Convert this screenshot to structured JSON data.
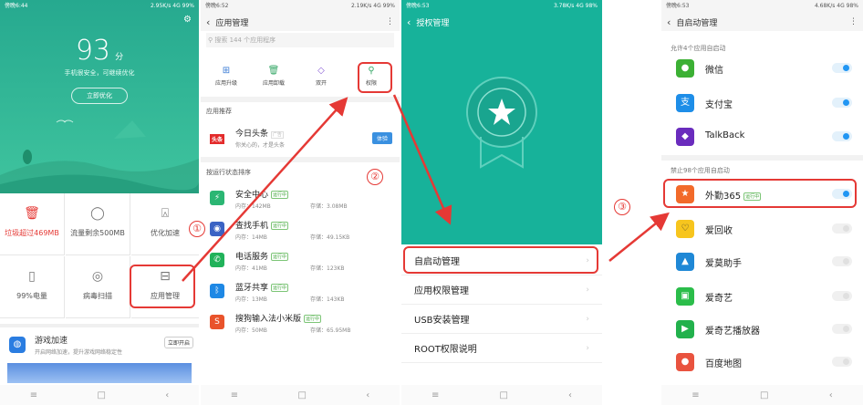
{
  "p1": {
    "status_left": "傍晚6:44",
    "status_right": "2.95K/s 4G 99%",
    "score": "93",
    "score_unit": "分",
    "status_msg": "手机很安全，可继续优化",
    "optimize": "立即优化",
    "grid": [
      {
        "label": "垃圾超过469MB",
        "icon": "trash-icon",
        "glyph": "🗑",
        "color": "#e53935"
      },
      {
        "label": "流量剩余500MB",
        "icon": "drop-icon",
        "glyph": "◯",
        "color": "#555555"
      },
      {
        "label": "优化加速",
        "icon": "rocket-icon",
        "glyph": "⍓",
        "color": "#555555"
      },
      {
        "label": "99%电量",
        "icon": "battery-icon",
        "glyph": "▯",
        "color": "#555555"
      },
      {
        "label": "病毒扫描",
        "icon": "shield-scan-icon",
        "glyph": "◎",
        "color": "#555555"
      },
      {
        "label": "应用管理",
        "icon": "app-box-icon",
        "glyph": "⊟",
        "color": "#555555"
      }
    ],
    "game_title": "游戏加速",
    "game_desc": "开启网络加速，提升游戏网络稳定性",
    "game_btn": "立即开启"
  },
  "p2": {
    "status_left": "傍晚6:52",
    "status_right": "2.19K/s 4G 99%",
    "title": "应用管理",
    "search_placeholder": "搜索 144 个应用程序",
    "tabs": [
      {
        "label": "应用升级",
        "icon": "upgrade-icon",
        "glyph": "⊞"
      },
      {
        "label": "应用卸载",
        "icon": "uninstall-icon",
        "glyph": "🗑"
      },
      {
        "label": "双开",
        "icon": "dual-icon",
        "glyph": "◇"
      },
      {
        "label": "权限",
        "icon": "permission-icon",
        "glyph": "⚲"
      }
    ],
    "rec_header": "应用推荐",
    "rec_logo": "头条",
    "rec_title": "今日头条",
    "rec_tag": "广告",
    "rec_desc": "你关心的，才是头条",
    "rec_btn": "体验",
    "sort_header": "按运行状态排序",
    "running_badge": "运行中",
    "apps": [
      {
        "name": "安全中心",
        "mem": "内存：142MB",
        "store": "",
        "icon": "security-center-icon",
        "color": "#2bb673"
      },
      {
        "name": "查找手机",
        "mem": "内存：14MB",
        "store": "存储：49.15KB",
        "icon": "find-phone-icon",
        "color": "#3b63c4"
      },
      {
        "name": "电话服务",
        "mem": "内存：41MB",
        "store": "存储：123KB",
        "icon": "phone-service-icon",
        "color": "#21b25a"
      },
      {
        "name": "蓝牙共享",
        "mem": "内存：13MB",
        "store": "存储：143KB",
        "icon": "bluetooth-icon",
        "color": "#1e88e5"
      },
      {
        "name": "搜狗输入法小米版",
        "mem": "内存：50MB",
        "store": "存储：65.95MB",
        "icon": "sogou-icon",
        "color": "#e9532b"
      }
    ],
    "partial_store": "存储：3.08MB"
  },
  "p3": {
    "status_left": "傍晚6:53",
    "status_right": "3.78K/s 4G 98%",
    "title": "授权管理",
    "menu": [
      "自启动管理",
      "应用权限管理",
      "USB安装管理",
      "ROOT权限说明"
    ]
  },
  "p4": {
    "status_left": "傍晚6:53",
    "status_right": "4.68K/s 4G 98%",
    "title": "自启动管理",
    "allowed_header": "允许4个应用自启动",
    "allowed": [
      {
        "name": "微信",
        "icon": "wechat-icon",
        "glyph": "●",
        "color": "#3cb034"
      },
      {
        "name": "支付宝",
        "icon": "alipay-icon",
        "glyph": "支",
        "color": "#1e8ee8"
      },
      {
        "name": "TalkBack",
        "icon": "talkback-icon",
        "glyph": "◆",
        "color": "#6a2cbd"
      }
    ],
    "blocked_header": "禁止98个应用自启动",
    "blocked": [
      {
        "name": "外勤365",
        "icon": "waiqin-icon",
        "glyph": "★",
        "color": "#f26a2a",
        "on": true,
        "badge": "运行中"
      },
      {
        "name": "爱回收",
        "icon": "aihuishou-icon",
        "glyph": "♡",
        "color": "#f7c51e",
        "on": false,
        "badge": ""
      },
      {
        "name": "爱莫助手",
        "icon": "aimo-icon",
        "glyph": "▲",
        "color": "#1f88d6",
        "on": false,
        "badge": ""
      },
      {
        "name": "爱奇艺",
        "icon": "iqiyi-icon",
        "glyph": "▣",
        "color": "#2bbd4a",
        "on": false,
        "badge": ""
      },
      {
        "name": "爱奇艺播放器",
        "icon": "iqiyi-player-icon",
        "glyph": "▶",
        "color": "#22b14c",
        "on": false,
        "badge": ""
      },
      {
        "name": "百度地图",
        "icon": "baidu-map-icon",
        "glyph": "●",
        "color": "#e9533f",
        "on": false,
        "badge": ""
      }
    ]
  },
  "steps": [
    "①",
    "②",
    "③"
  ],
  "nav": {
    "menu": "≡",
    "home": "□",
    "back": "‹"
  }
}
